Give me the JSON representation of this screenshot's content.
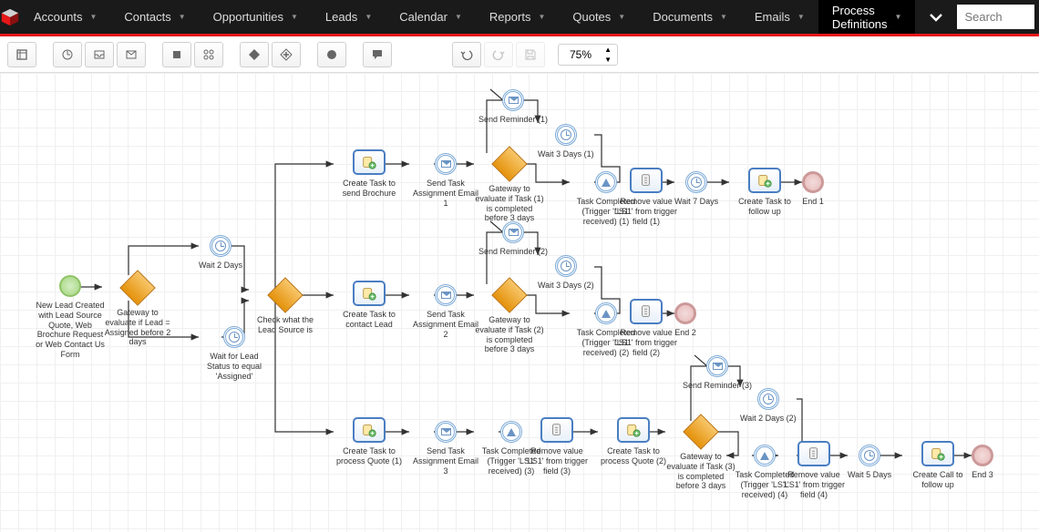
{
  "nav": {
    "items": [
      "Accounts",
      "Contacts",
      "Opportunities",
      "Leads",
      "Calendar",
      "Reports",
      "Quotes",
      "Documents",
      "Emails",
      "Process Definitions"
    ],
    "active": "Process Definitions",
    "search_placeholder": "Search"
  },
  "toolbar": {
    "zoom": "75%"
  },
  "nodes": {
    "start": {
      "label": "New Lead Created with Lead Source Quote, Web Brochure Request or Web Contact Us Form"
    },
    "gw1": {
      "label": "Gateway to evaluate if Lead = Assigned before 2 days"
    },
    "wait2d": {
      "label": "Wait 2 Days"
    },
    "waitAssigned": {
      "label": "Wait for Lead Status to equal 'Assigned'"
    },
    "gwCheckSource": {
      "label": "Check what the Lead Source is"
    },
    "taskBrochure": {
      "label": "Create Task to send Brochure"
    },
    "taskContact": {
      "label": "Create Task to contact Lead"
    },
    "taskQuote": {
      "label": "Create Task to process Quote (1)"
    },
    "email1": {
      "label": "Send Task Assignment Email 1"
    },
    "email2": {
      "label": "Send Task Assignment Email 2"
    },
    "email3": {
      "label": "Send Task Assignment Email 3"
    },
    "gwEval1": {
      "label": "Gateway to evaluate if Task (1) is completed before 3 days"
    },
    "gwEval2": {
      "label": "Gateway to evaluate if Task (2) is completed before 3 days"
    },
    "gwEval3": {
      "label": "Gateway to evaluate if Task (3) is completed before 3 days"
    },
    "reminder1": {
      "label": "Send Reminder (1)"
    },
    "reminder2": {
      "label": "Send Reminder (2)"
    },
    "reminder3": {
      "label": "Send Reminder (3)"
    },
    "wait3d1": {
      "label": "Wait 3 Days (1)"
    },
    "wait3d2": {
      "label": "Wait 3 Days (2)"
    },
    "wait2d2": {
      "label": "Wait 2 Days (2)"
    },
    "tc1": {
      "label": "Task Completed (Trigger 'LS1' received) (1)"
    },
    "tc2": {
      "label": "Task Completed (Trigger 'LS1' received) (2)"
    },
    "tc3": {
      "label": "Task Completed (Trigger 'LS1' received) (3)"
    },
    "tc4": {
      "label": "Task Completed (Trigger 'LS1' received) (4)"
    },
    "rv1": {
      "label": "Remove value 'LS1' from trigger field (1)"
    },
    "rv2": {
      "label": "Remove value 'LS1' from trigger field (2)"
    },
    "rv3": {
      "label": "Remove value 'LS1' from trigger field (3)"
    },
    "rv4": {
      "label": "Remove value 'LS1' from trigger field (4)"
    },
    "wait7d": {
      "label": "Wait 7 Days"
    },
    "wait5d": {
      "label": "Wait 5 Days"
    },
    "taskFollow": {
      "label": "Create Task to follow up"
    },
    "taskQuote2": {
      "label": "Create Task to process Quote (2)"
    },
    "callFollow": {
      "label": "Create Call to follow up"
    },
    "end1": {
      "label": "End 1"
    },
    "end2": {
      "label": "End 2"
    },
    "end3": {
      "label": "End 3"
    }
  }
}
